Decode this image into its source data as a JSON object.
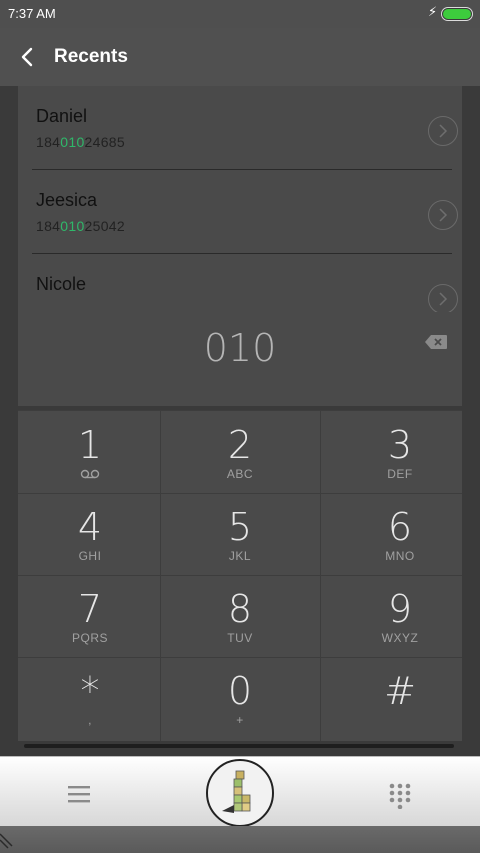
{
  "status_bar": {
    "time": "7:37 AM"
  },
  "header": {
    "title": "Recents"
  },
  "contacts": [
    {
      "name": "Daniel",
      "number_prefix": "184",
      "number_match": "010",
      "number_suffix": "24685"
    },
    {
      "name": "Jeesica",
      "number_prefix": "184",
      "number_match": "010",
      "number_suffix": "25042"
    },
    {
      "name": "Nicole"
    }
  ],
  "dialer": {
    "digits": "010"
  },
  "keypad": {
    "keys": [
      {
        "num": "1",
        "letters": ""
      },
      {
        "num": "2",
        "letters": "ABC"
      },
      {
        "num": "3",
        "letters": "DEF"
      },
      {
        "num": "4",
        "letters": "GHI"
      },
      {
        "num": "5",
        "letters": "JKL"
      },
      {
        "num": "6",
        "letters": "MNO"
      },
      {
        "num": "7",
        "letters": "PQRS"
      },
      {
        "num": "8",
        "letters": "TUV"
      },
      {
        "num": "9",
        "letters": "WXYZ"
      },
      {
        "num": "*",
        "letters": ","
      },
      {
        "num": "0",
        "letters": "+"
      },
      {
        "num": "#",
        "letters": ""
      }
    ]
  },
  "icons": {
    "back": "back-arrow-icon",
    "chevron": "chevron-right-icon",
    "backspace": "backspace-icon",
    "voicemail": "voicemail-icon",
    "menu": "menu-icon",
    "call": "call-button-icon",
    "keypad": "dialpad-icon"
  },
  "colors": {
    "match_highlight": "#2fb86a",
    "battery": "#3dcc3d"
  }
}
